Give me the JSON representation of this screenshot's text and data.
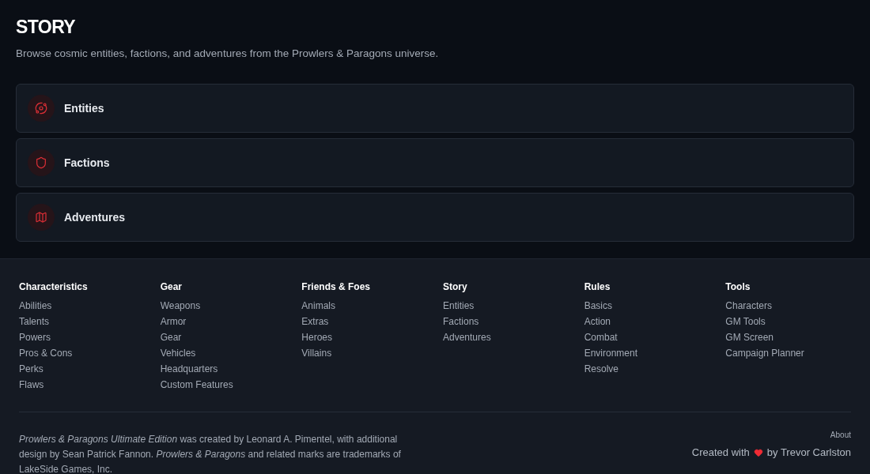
{
  "page": {
    "title": "STORY",
    "subtitle": "Browse cosmic entities, factions, and adventures from the Prowlers & Paragons universe."
  },
  "categories": [
    {
      "label": "Entities"
    },
    {
      "label": "Factions"
    },
    {
      "label": "Adventures"
    }
  ],
  "footer": {
    "columns": [
      {
        "heading": "Characteristics",
        "links": [
          "Abilities",
          "Talents",
          "Powers",
          "Pros & Cons",
          "Perks",
          "Flaws"
        ]
      },
      {
        "heading": "Gear",
        "links": [
          "Weapons",
          "Armor",
          "Gear",
          "Vehicles",
          "Headquarters",
          "Custom Features"
        ]
      },
      {
        "heading": "Friends & Foes",
        "links": [
          "Animals",
          "Extras",
          "Heroes",
          "Villains"
        ]
      },
      {
        "heading": "Story",
        "links": [
          "Entities",
          "Factions",
          "Adventures"
        ]
      },
      {
        "heading": "Rules",
        "links": [
          "Basics",
          "Action",
          "Combat",
          "Environment",
          "Resolve"
        ]
      },
      {
        "heading": "Tools",
        "links": [
          "Characters",
          "GM Tools",
          "GM Screen",
          "Campaign Planner"
        ]
      }
    ],
    "legal": "*Prowlers & Paragons Ultimate Edition* was created by Leonard A. Pimentel, with additional design by Sean Patrick Fannon. *Prowlers & Paragons* and related marks are trademarks of LakeSide Games, Inc.",
    "about": "About",
    "credit": {
      "prefix": "Created with",
      "suffix": "by Trevor Carlston"
    }
  }
}
